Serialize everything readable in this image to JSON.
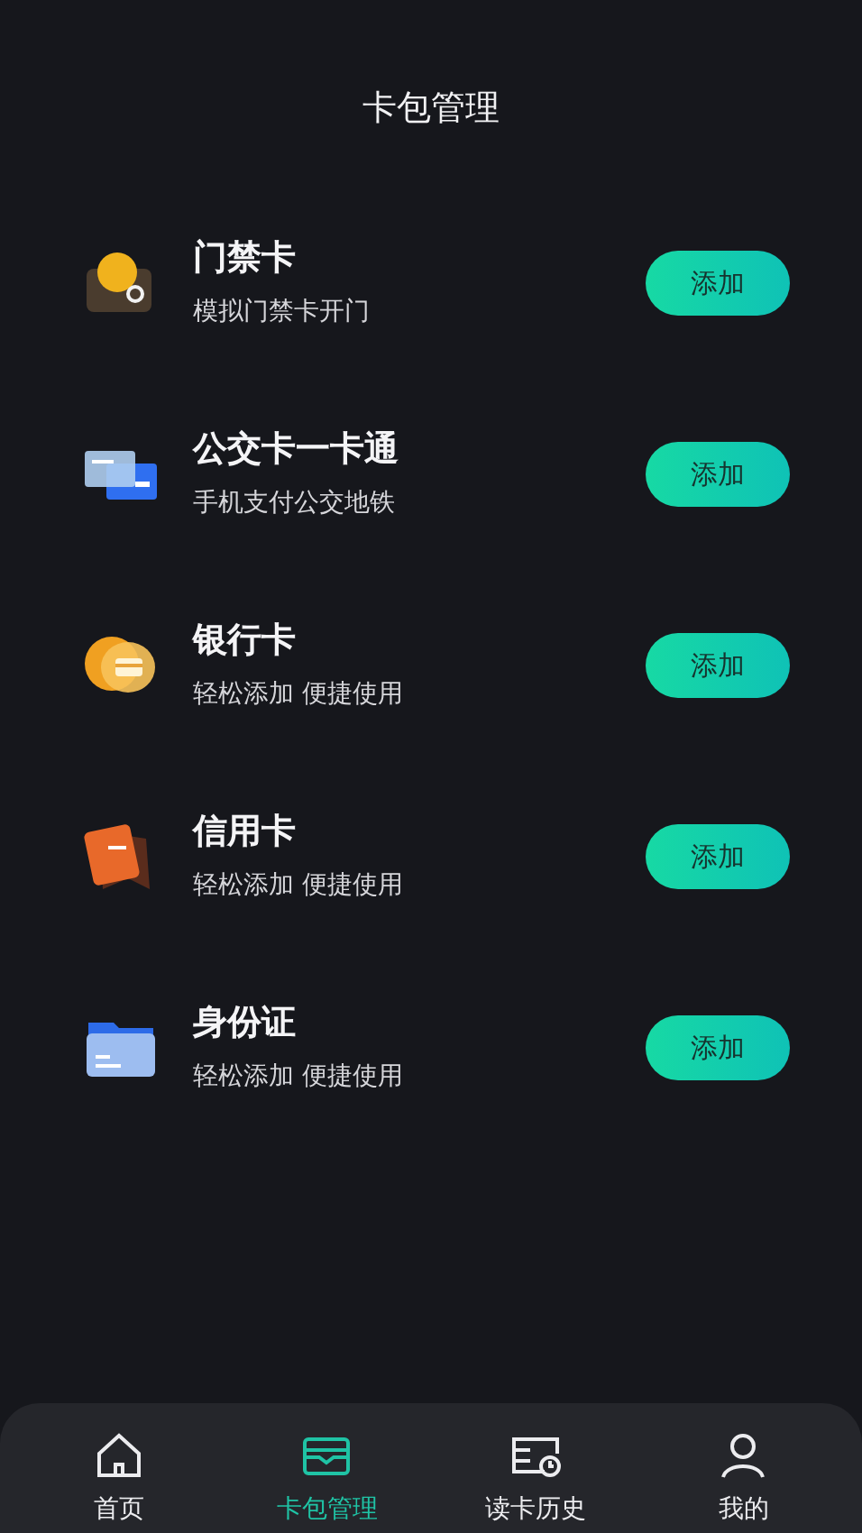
{
  "header": {
    "title": "卡包管理"
  },
  "cards": [
    {
      "kind": "access",
      "name": "门禁卡",
      "description": "模拟门禁卡开门",
      "action": "添加"
    },
    {
      "kind": "transit",
      "name": "公交卡一卡通",
      "description": "手机支付公交地铁",
      "action": "添加"
    },
    {
      "kind": "bank",
      "name": "银行卡",
      "description": "轻松添加 便捷使用",
      "action": "添加"
    },
    {
      "kind": "credit",
      "name": "信用卡",
      "description": "轻松添加 便捷使用",
      "action": "添加"
    },
    {
      "kind": "id",
      "name": "身份证",
      "description": "轻松添加 便捷使用",
      "action": "添加"
    }
  ],
  "tab_bar": [
    {
      "kind": "home",
      "label": "首页",
      "selected": false
    },
    {
      "kind": "wallet",
      "label": "卡包管理",
      "selected": true
    },
    {
      "kind": "history",
      "label": "读卡历史",
      "selected": false
    },
    {
      "kind": "profile",
      "label": "我的",
      "selected": false
    }
  ]
}
